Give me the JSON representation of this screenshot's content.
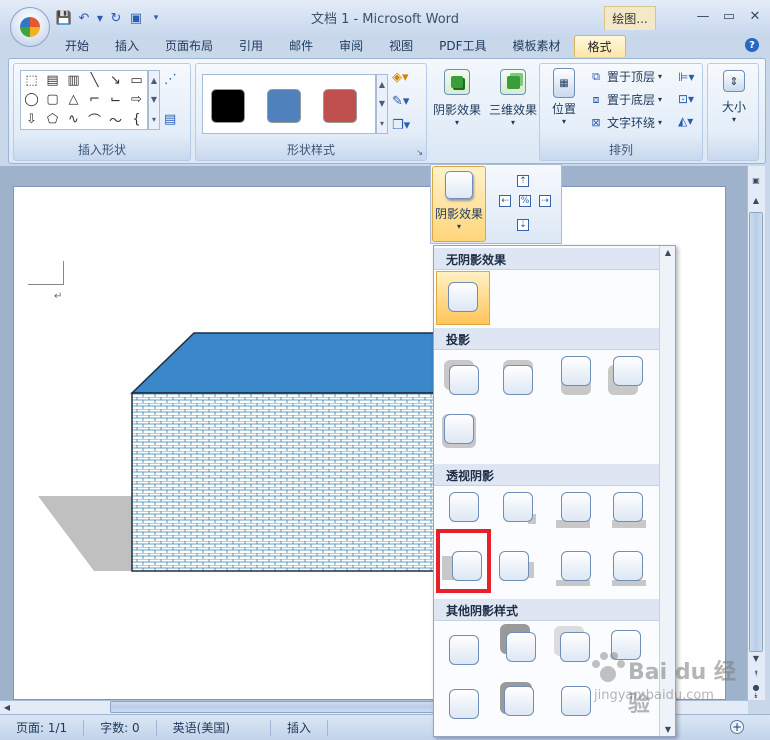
{
  "window": {
    "title": "文档 1 - Microsoft Word",
    "context_tab": "绘图..."
  },
  "tabs": [
    "开始",
    "插入",
    "页面布局",
    "引用",
    "邮件",
    "审阅",
    "视图",
    "PDF工具",
    "模板素材",
    "格式"
  ],
  "ribbon": {
    "groups": {
      "insert_shapes": "插入形状",
      "shape_styles": "形状样式",
      "arrange": "排列"
    },
    "buttons": {
      "shadow_effects": "阴影效果",
      "effects_3d": "三维效果",
      "position": "位置",
      "bring_front": "置于顶层",
      "send_back": "置于底层",
      "text_wrap": "文字环绕",
      "size": "大小"
    },
    "swatch_colors": [
      "#000000",
      "#4f81bd",
      "#c0504d"
    ]
  },
  "shadow_popup": {
    "button_label": "阴影效果"
  },
  "menu": {
    "sections": [
      "无阴影效果",
      "投影",
      "透视阴影",
      "其他阴影样式"
    ]
  },
  "statusbar": {
    "page": "页面: 1/1",
    "words": "字数: 0",
    "language": "英语(美国)",
    "mode": "插入"
  },
  "watermark": {
    "logo": "Bai du 经验",
    "url": "jingyan.baidu.com"
  }
}
